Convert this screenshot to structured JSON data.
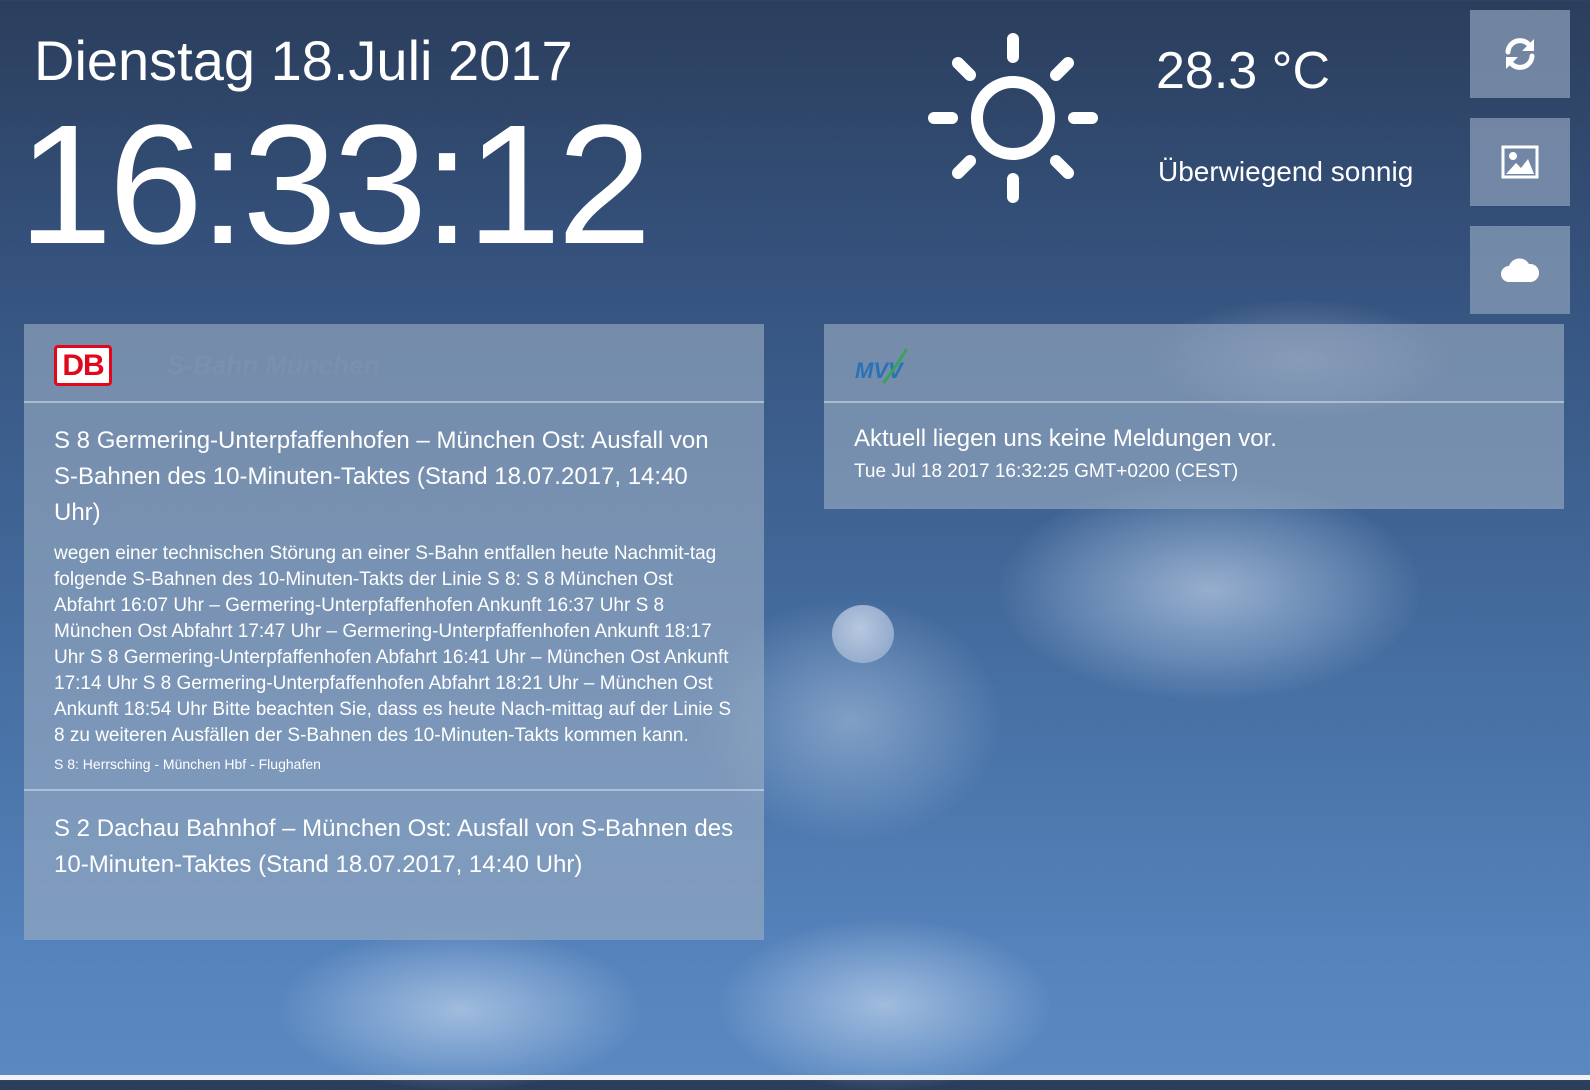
{
  "header": {
    "date": "Dienstag 18.Juli 2017",
    "time": "16:33:12"
  },
  "weather": {
    "icon": "sun-icon",
    "temperature": "28.3 °C",
    "condition": "Überwiegend sonnig"
  },
  "side_buttons": [
    {
      "icon": "refresh-icon"
    },
    {
      "icon": "image-icon"
    },
    {
      "icon": "cloud-icon"
    }
  ],
  "db_panel": {
    "logo_text": "DB",
    "service_name": "S-Bahn München",
    "messages": [
      {
        "title": "S 8 Germering-Unterpfaffenhofen – München Ost: Ausfall von S-Bahnen des 10-Minuten-Taktes (Stand 18.07.2017, 14:40 Uhr)",
        "body": "wegen einer technischen Störung an einer S-Bahn entfallen heute Nachmit-tag folgende S-Bahnen des 10-Minuten-Takts der Linie S 8: S 8 München Ost Abfahrt 16:07 Uhr – Germering-Unterpfaffenhofen Ankunft 16:37 Uhr S 8 München Ost Abfahrt 17:47 Uhr – Germering-Unterpfaffenhofen Ankunft 18:17 Uhr S 8 Germering-Unterpfaffenhofen Abfahrt 16:41 Uhr – München Ost Ankunft 17:14 Uhr S 8 Germering-Unterpfaffenhofen Abfahrt 18:21 Uhr – München Ost Ankunft 18:54 Uhr Bitte beachten Sie, dass es heute Nach-mittag auf der Linie S 8 zu weiteren Ausfällen der S-Bahnen des 10-Minuten-Takts kommen kann.",
        "line": "S 8: Herrsching - München Hbf - Flughafen"
      },
      {
        "title": "S 2 Dachau Bahnhof – München Ost: Ausfall von S-Bahnen des 10-Minuten-Taktes (Stand 18.07.2017, 14:40 Uhr)"
      }
    ]
  },
  "mvv_panel": {
    "logo_text": "MVV",
    "message": "Aktuell liegen uns keine Meldungen vor.",
    "timestamp": "Tue Jul 18 2017 16:32:25 GMT+0200 (CEST)"
  },
  "colors": {
    "db_red": "#e2081c",
    "mvv_blue": "#2a72b8",
    "mvv_green": "#3aa35a"
  }
}
